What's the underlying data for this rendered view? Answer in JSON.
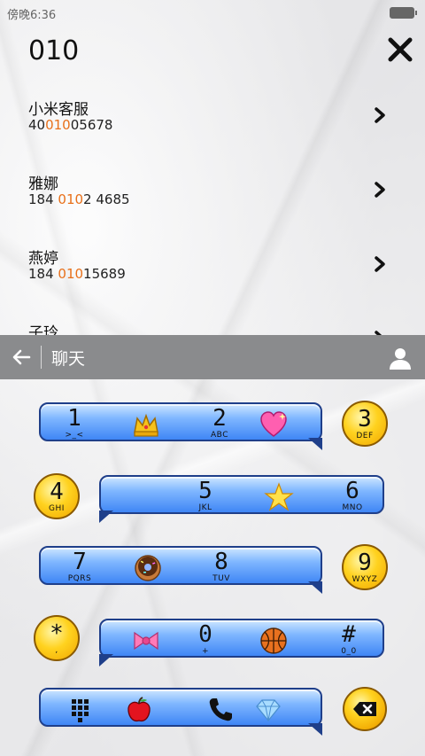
{
  "status_bar": {
    "time": "傍晚6:36"
  },
  "search": {
    "query": "010"
  },
  "results": [
    {
      "name": "小米客服",
      "number_pre": "40",
      "number_match": "010",
      "number_post": "05678"
    },
    {
      "name": "雅娜",
      "number_pre": "184 ",
      "number_match": "010",
      "number_post": "2 4685"
    },
    {
      "name": "燕婷",
      "number_pre": "184 ",
      "number_match": "010",
      "number_post": "15689"
    },
    {
      "name": "子玲",
      "number_pre": "",
      "number_match": "",
      "number_post": ""
    }
  ],
  "chat_bar": {
    "title": "聊天"
  },
  "keypad": {
    "k1": {
      "digit": "1",
      "letters": ">_<"
    },
    "k2": {
      "digit": "2",
      "letters": "ABC"
    },
    "k3": {
      "digit": "3",
      "letters": "DEF"
    },
    "k4": {
      "digit": "4",
      "letters": "GHI"
    },
    "k5": {
      "digit": "5",
      "letters": "JKL"
    },
    "k6": {
      "digit": "6",
      "letters": "MNO"
    },
    "k7": {
      "digit": "7",
      "letters": "PQRS"
    },
    "k8": {
      "digit": "8",
      "letters": "TUV"
    },
    "k9": {
      "digit": "9",
      "letters": "WXYZ"
    },
    "kstar": {
      "digit": "*",
      "letters": ","
    },
    "k0": {
      "digit": "0",
      "letters": "+"
    },
    "khash": {
      "digit": "#",
      "letters": "0_0"
    }
  },
  "icons": {
    "crown": "crown-icon",
    "heart": "heart-icon",
    "star": "star-icon",
    "donut": "donut-icon",
    "bow": "bow-icon",
    "basketball": "basketball-icon",
    "dialpad": "dialpad-icon",
    "apple": "apple-icon",
    "phone": "phone-icon",
    "diamond": "diamond-icon"
  },
  "colors": {
    "match_highlight": "#e8701a",
    "bubble_blue": "#3f86f5",
    "key_yellow": "#ffd21f"
  }
}
